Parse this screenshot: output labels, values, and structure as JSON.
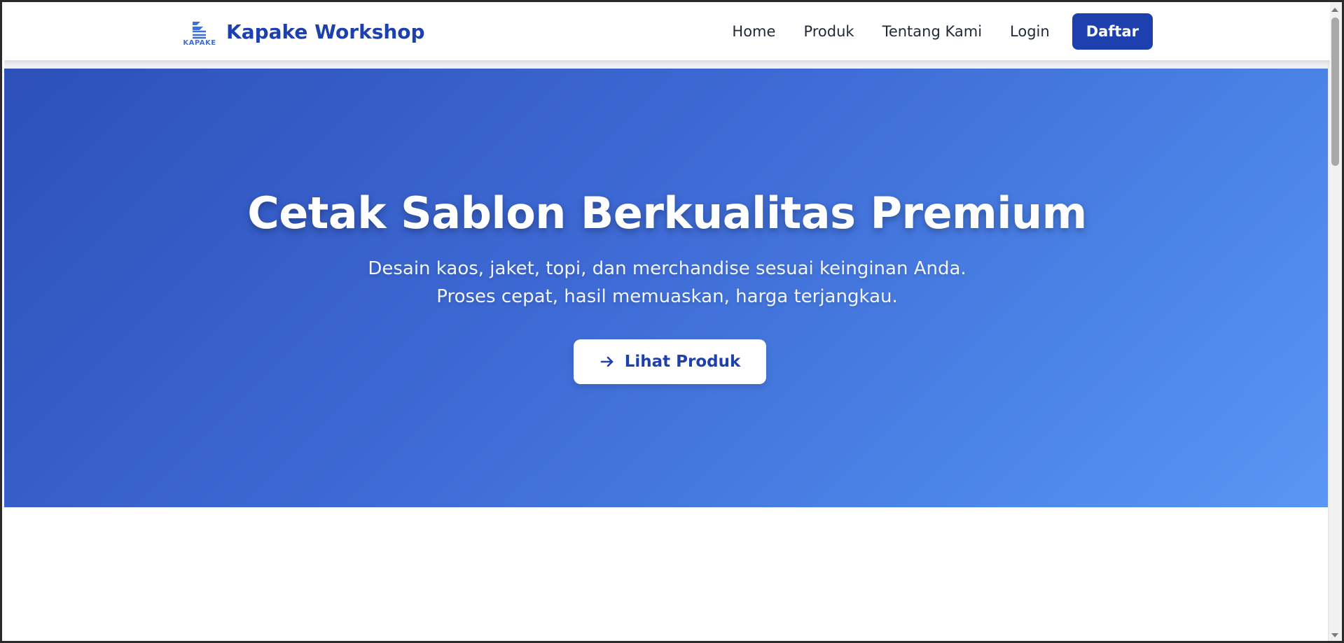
{
  "brand": {
    "logo_caption": "KAPAKE",
    "name": "Kapake Workshop",
    "color": "#1e40af"
  },
  "nav": {
    "items": [
      {
        "label": "Home"
      },
      {
        "label": "Produk"
      },
      {
        "label": "Tentang Kami"
      },
      {
        "label": "Login"
      }
    ],
    "cta_label": "Daftar"
  },
  "hero": {
    "title": "Cetak Sablon Berkualitas Premium",
    "subtitle_line1": "Desain kaos, jaket, topi, dan merchandise sesuai keinginan Anda.",
    "subtitle_line2": "Proses cepat, hasil memuaskan, harga terjangkau.",
    "button_label": "Lihat Produk",
    "button_icon": "arrow-right-icon",
    "gradient_start": "#2d50b9",
    "gradient_end": "#5a96f4"
  }
}
